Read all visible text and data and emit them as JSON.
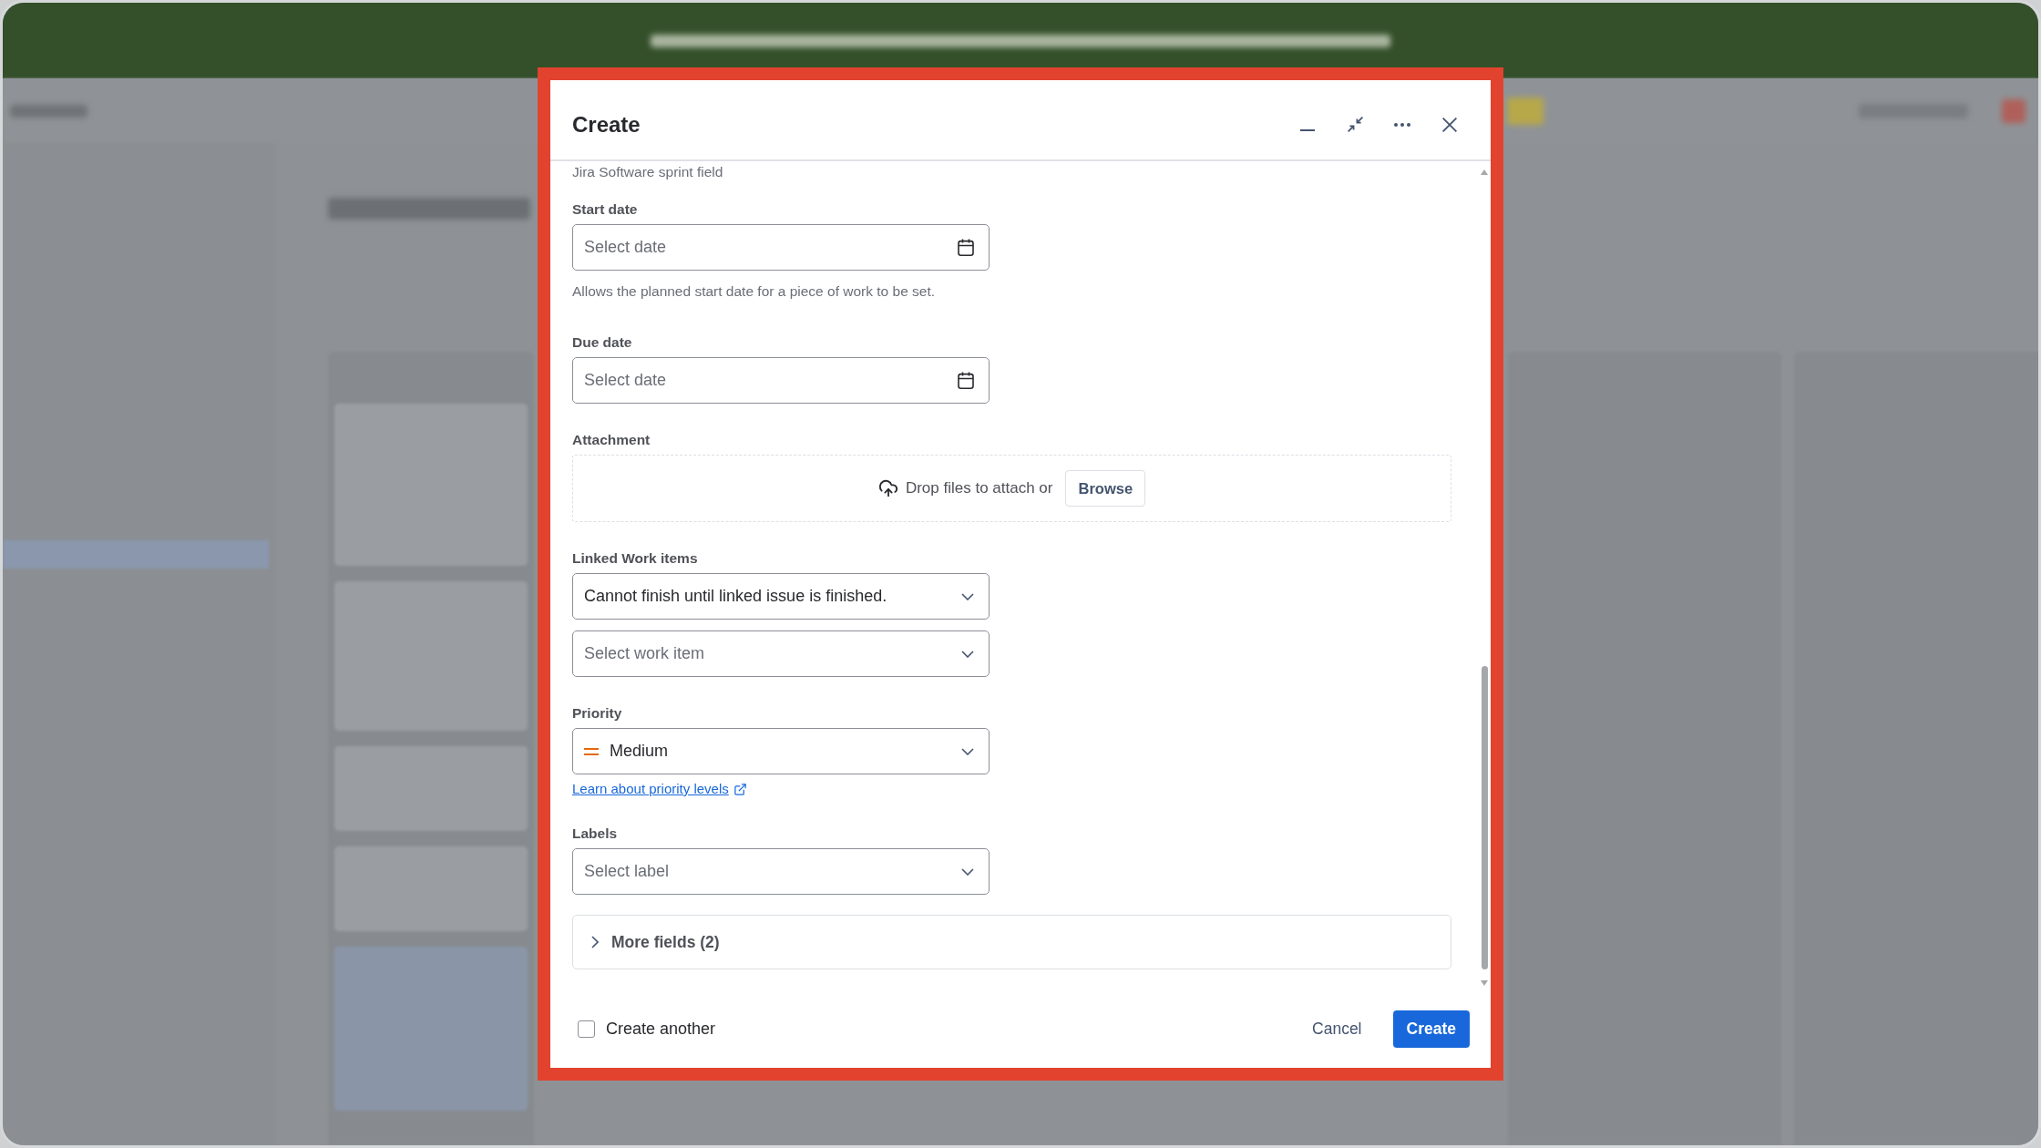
{
  "dialog": {
    "title": "Create"
  },
  "form": {
    "partial_text": "Jira Software sprint field",
    "fields": [
      {
        "kind": "date",
        "label": "Start date",
        "placeholder": "Select date",
        "help": "Allows the planned start date for a piece of work to be set."
      },
      {
        "kind": "date",
        "label": "Due date",
        "placeholder": "Select date"
      },
      {
        "kind": "attachment",
        "label": "Attachment",
        "prompt": "Drop files to attach or",
        "button": "Browse"
      },
      {
        "kind": "select_group",
        "label": "Linked Work items",
        "selects": [
          {
            "value": "Cannot finish until linked issue is finished."
          },
          {
            "placeholder": "Select work item"
          }
        ]
      },
      {
        "kind": "priority",
        "label": "Priority",
        "value": "Medium",
        "link": "Learn about priority levels"
      },
      {
        "kind": "select",
        "label": "Labels",
        "placeholder": "Select label"
      }
    ],
    "more_fields": {
      "label": "More fields (2)",
      "expanded": false
    }
  },
  "footer": {
    "create_another": {
      "label": "Create another",
      "checked": false
    },
    "buttons": [
      {
        "kind": "subtle",
        "label": "Cancel"
      },
      {
        "kind": "primary",
        "label": "Create"
      }
    ]
  }
}
